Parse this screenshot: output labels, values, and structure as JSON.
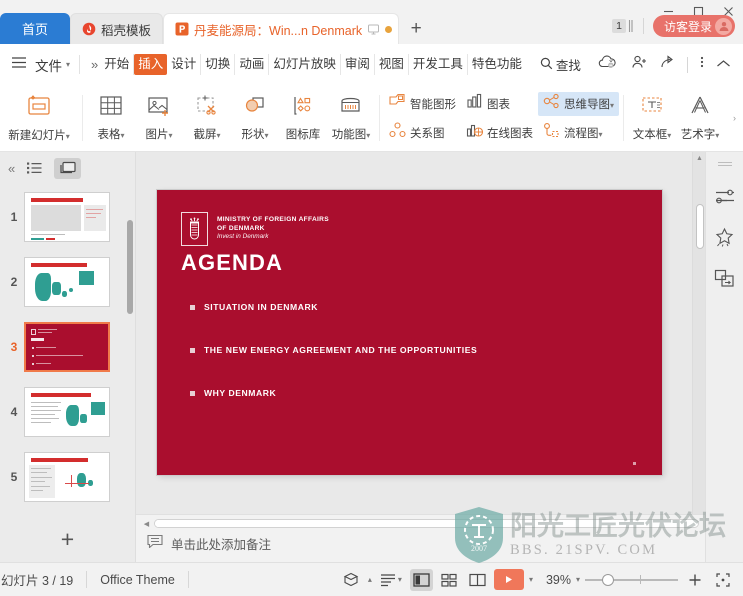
{
  "window": {
    "minimize": "minimize-icon",
    "maximize": "maximize-icon",
    "close": "close-icon"
  },
  "tabbar": {
    "home_tab": "首页",
    "docker_tab": "稻壳模板",
    "active_tab": "丹麦能源局：Win...n Denmark",
    "new_tab": "+",
    "tab_count": "1",
    "guest_login": "访客登录"
  },
  "menu": {
    "file": "文件",
    "overflow": "»",
    "tabs": [
      {
        "label": "开始",
        "active": false
      },
      {
        "label": "插入",
        "active": true
      },
      {
        "label": "设计",
        "active": false
      },
      {
        "label": "切换",
        "active": false
      },
      {
        "label": "动画",
        "active": false
      },
      {
        "label": "幻灯片放映",
        "active": false
      },
      {
        "label": "审阅",
        "active": false
      },
      {
        "label": "视图",
        "active": false
      },
      {
        "label": "开发工具",
        "active": false
      },
      {
        "label": "特色功能",
        "active": false
      }
    ],
    "find": "查找"
  },
  "ribbon": {
    "new_slide": "新建幻灯片",
    "table": "表格",
    "picture": "图片",
    "screenshot": "截屏",
    "shape": "形状",
    "icon_library": "图标库",
    "function_chart": "功能图",
    "smart_art": "智能图形",
    "relation_chart": "关系图",
    "chart": "图表",
    "online_chart": "在线图表",
    "mind_map": "思维导图",
    "flow_chart": "流程图",
    "textbox": "文本框",
    "word_art": "艺术字"
  },
  "thumbnails": {
    "slides": [
      {
        "number": "1",
        "current": false
      },
      {
        "number": "2",
        "current": false
      },
      {
        "number": "3",
        "current": true
      },
      {
        "number": "4",
        "current": false
      },
      {
        "number": "5",
        "current": false
      }
    ],
    "add_slide": "+"
  },
  "slide": {
    "background_color": "#aa0e2e",
    "logo_line1": "MINISTRY OF FOREIGN AFFAIRS",
    "logo_line2": "OF DENMARK",
    "logo_line3": "Invest in Denmark",
    "title": "AGENDA",
    "bullets": [
      "SITUATION IN DENMARK",
      "THE NEW ENERGY AGREEMENT AND THE OPPORTUNITIES",
      "WHY DENMARK"
    ]
  },
  "notes": {
    "placeholder": "单击此处添加备注"
  },
  "status": {
    "slide_counter": "幻灯片 3 / 19",
    "theme": "Office Theme",
    "zoom": "39%"
  },
  "watermark": {
    "line1": "阳光工匠光伏论坛",
    "line2": "BBS. 21SPV. COM",
    "year": "2007",
    "color": "#6aa9a3"
  }
}
